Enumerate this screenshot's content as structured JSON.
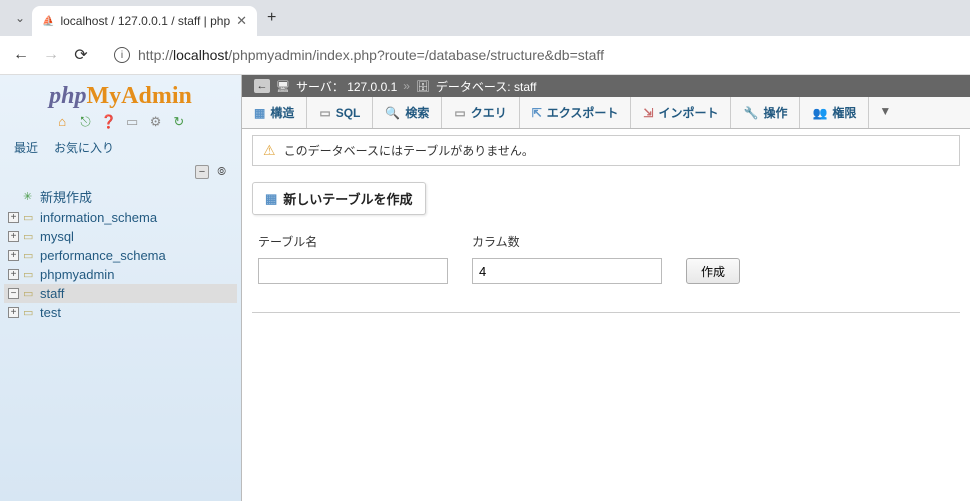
{
  "browser": {
    "tab_title": "localhost / 127.0.0.1 / staff | php",
    "url_prefix": "http://",
    "url_host": "localhost",
    "url_rest": "/phpmyadmin/index.php?route=/database/structure&db=staff"
  },
  "logo": {
    "part1": "php",
    "part2": "My",
    "part3": "Admin"
  },
  "side_tabs": {
    "recent": "最近",
    "favorites": "お気に入り"
  },
  "tree": {
    "new_label": "新規作成",
    "items": [
      {
        "label": "information_schema"
      },
      {
        "label": "mysql"
      },
      {
        "label": "performance_schema"
      },
      {
        "label": "phpmyadmin"
      },
      {
        "label": "staff"
      },
      {
        "label": "test"
      }
    ]
  },
  "breadcrumb": {
    "server_label": "サーバ：",
    "server_value": "127.0.0.1",
    "db_label": "データベース:",
    "db_value": "staff"
  },
  "topnav": {
    "structure": "構造",
    "sql": "SQL",
    "search": "検索",
    "query": "クエリ",
    "export": "エクスポート",
    "import": "インポート",
    "operations": "操作",
    "privileges": "権限"
  },
  "message": {
    "text": "このデータベースにはテーブルがありません。"
  },
  "panel": {
    "title": "新しいテーブルを作成",
    "table_name_label": "テーブル名",
    "columns_label": "カラム数",
    "columns_value": "4",
    "submit": "作成"
  }
}
